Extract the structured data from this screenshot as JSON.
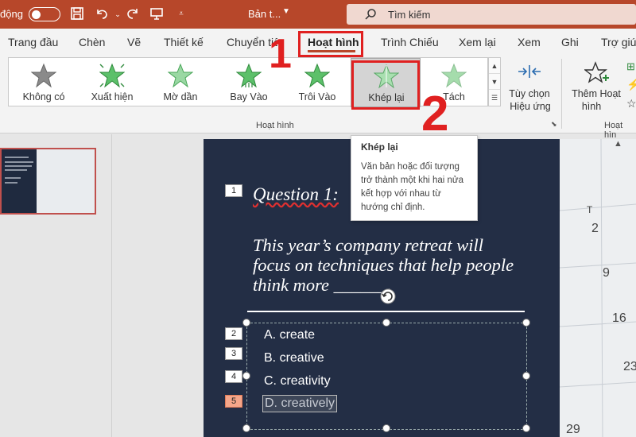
{
  "titlebar": {
    "autosave_label": "động",
    "doc_title": "Bản t...",
    "search_placeholder": "Tìm kiếm",
    "icons": [
      "save-icon",
      "undo-icon",
      "redo-icon",
      "present-icon",
      "customize-icon"
    ]
  },
  "tabs": [
    "Trang đầu",
    "Chèn",
    "Vẽ",
    "Thiết kế",
    "Chuyển tiếp",
    "Hoạt hình",
    "Trình Chiếu",
    "Xem lại",
    "Xem",
    "Ghi",
    "Trợ giúp"
  ],
  "active_tab": "Hoạt hình",
  "gallery": {
    "items": [
      "Không có",
      "Xuất hiện",
      "Mờ dần",
      "Bay Vào",
      "Trôi Vào",
      "Khép lại",
      "Tách"
    ],
    "selected": "Khép lại"
  },
  "ribbon": {
    "effect_options_label_1": "Tùy chọn",
    "effect_options_label_2": "Hiệu ứng",
    "group_label": "Hoạt hình",
    "add_animation_label_1": "Thêm Hoạt",
    "add_animation_label_2": "hình",
    "group_label_2": "Hoạt hìn"
  },
  "markers": {
    "one": "1",
    "two": "2"
  },
  "tooltip": {
    "title": "Khép lại",
    "description": "Văn bản hoặc đối tượng trở thành một khi hai nửa kết hợp với nhau từ hướng chỉ định."
  },
  "slide": {
    "question_title": "Question 1:",
    "question_body": "This year’s company retreat will focus on techniques that help people think more ______.",
    "answers": [
      "A. create",
      "B. creative",
      "C. creativity",
      "D. creatively"
    ],
    "animation_tags": [
      "1",
      "2",
      "3",
      "4",
      "5"
    ],
    "calendar_numbers": [
      "T",
      "2",
      "9",
      "16",
      "23",
      "29"
    ]
  },
  "colors": {
    "accent": "#b7472a",
    "highlight": "#e02020",
    "slide_bg": "#232e45"
  }
}
